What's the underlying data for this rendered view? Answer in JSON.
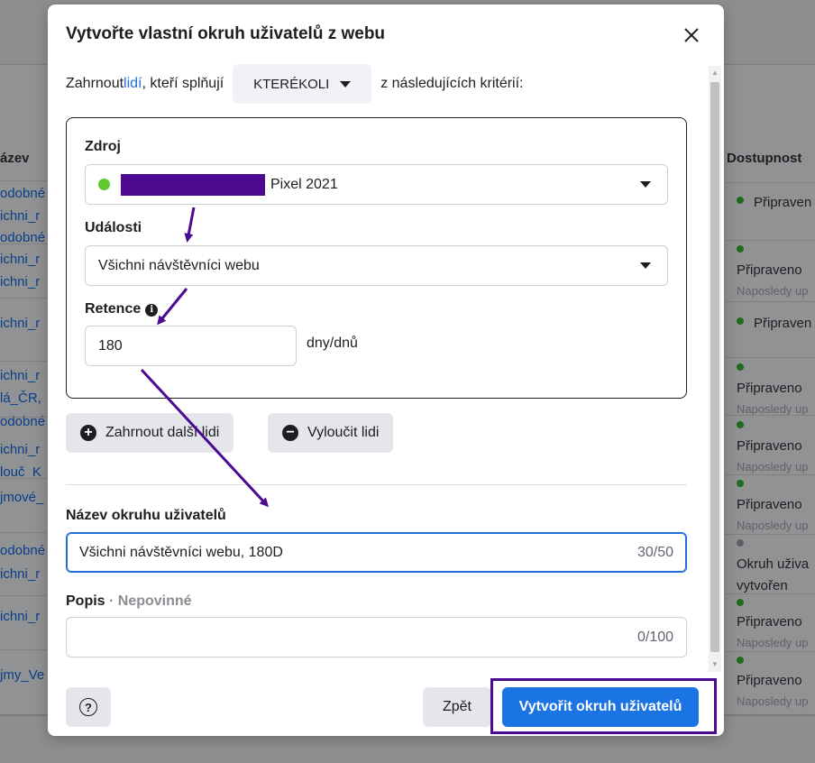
{
  "background": {
    "left_column_header": "ázev",
    "right_column_header": "Dostupnost",
    "left_items": [
      "odobné",
      "ichni_r",
      "odobné",
      "ichni_r",
      "ichni_r",
      "ichni_r",
      "ichni_r",
      "lá_ČR,",
      "odobné",
      "ichni_r",
      "louč_K",
      "jmové_",
      "odobné",
      "ichni_r",
      "ichni_r",
      "jmy_Ve"
    ],
    "statuses": [
      {
        "text": "Připraven",
        "sub": ""
      },
      {
        "text": "Připraveno",
        "sub": "Naposledy up"
      },
      {
        "text": "Připraven",
        "sub": ""
      },
      {
        "text": "Připraveno",
        "sub": "Naposledy up"
      },
      {
        "text": "Připraveno",
        "sub": "Naposledy up"
      },
      {
        "text": "Připraveno",
        "sub": "Naposledy up"
      },
      {
        "text": "Okruh uživa",
        "sub": "vytvořen"
      },
      {
        "text": "Připraveno",
        "sub": "Naposledy up"
      },
      {
        "text": "Připraveno",
        "sub": "Naposledy up"
      }
    ]
  },
  "modal": {
    "title": "Vytvořte vlastní okruh uživatelů z webu",
    "include_prefix": "Zahrnout ",
    "include_link": "lidí",
    "include_middle": ", kteří splňují",
    "match_select": "KTERÉKOLI",
    "include_suffix": "z následujících kritérií:",
    "source_label": "Zdroj",
    "source_value": "Pixel 2021",
    "events_label": "Události",
    "events_value": "Všichni návštěvníci webu",
    "retention_label": "Retence",
    "retention_value": "180",
    "retention_unit": "dny/dnů",
    "include_more_button": "Zahrnout další lidi",
    "exclude_button": "Vyloučit lidi",
    "audience_name_label": "Název okruhu uživatelů",
    "audience_name_value": "Všichni návštěvníci webu, 180D",
    "audience_name_counter": "30/50",
    "description_label": "Popis",
    "description_separator": " · ",
    "description_optional": "Nepovinné",
    "description_counter": "0/100",
    "back_button": "Zpět",
    "create_button": "Vytvořit okruh uživatelů"
  },
  "colors": {
    "primary": "#1b74e4",
    "annotation": "#4a0a91",
    "status_green": "#5fc82f"
  }
}
